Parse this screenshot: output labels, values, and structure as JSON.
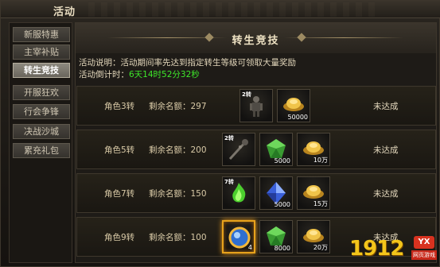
{
  "window": {
    "title": "活动"
  },
  "sidebar": {
    "items": [
      {
        "label": "新服特惠"
      },
      {
        "label": "主宰补贴"
      },
      {
        "label": "转生竞技"
      },
      {
        "label": "开服狂欢"
      },
      {
        "label": "行会争锋"
      },
      {
        "label": "决战沙城"
      },
      {
        "label": "累充礼包"
      }
    ],
    "active": "转生竞技"
  },
  "main": {
    "heading": "转生竞技",
    "description": "活动说明：活动期间率先达到指定转生等级可领取大量奖励",
    "countdown_label": "活动倒计时：",
    "countdown_value": "6天14时52分32秒",
    "rows": [
      {
        "role": "角色3转",
        "quota": "剩余名额：297",
        "status": "未达成",
        "rewards": [
          {
            "icon": "armor-figure-icon",
            "tag": "2转",
            "qty": ""
          },
          {
            "icon": "gold-ingot-icon",
            "tag": "",
            "qty": "50000"
          }
        ]
      },
      {
        "role": "角色5转",
        "quota": "剩余名额：200",
        "status": "未达成",
        "rewards": [
          {
            "icon": "spiked-club-icon",
            "tag": "2转",
            "qty": ""
          },
          {
            "icon": "green-gem-icon",
            "tag": "",
            "qty": "5000"
          },
          {
            "icon": "gold-ingot-icon",
            "tag": "",
            "qty": "10万"
          }
        ]
      },
      {
        "role": "角色7转",
        "quota": "剩余名额：150",
        "status": "未达成",
        "rewards": [
          {
            "icon": "green-flame-icon",
            "tag": "7转",
            "qty": ""
          },
          {
            "icon": "blue-crystal-icon",
            "tag": "",
            "qty": "5000"
          },
          {
            "icon": "gold-ingot-icon",
            "tag": "",
            "qty": "15万"
          }
        ]
      },
      {
        "role": "角色9转",
        "quota": "剩余名额：100",
        "status": "未达成",
        "rewards": [
          {
            "icon": "golden-orb-icon",
            "tag": "",
            "qty": "4"
          },
          {
            "icon": "green-gem-icon",
            "tag": "",
            "qty": "8000"
          },
          {
            "icon": "gold-ingot-icon",
            "tag": "",
            "qty": "20万"
          }
        ]
      }
    ]
  },
  "watermark": {
    "number": "1912",
    "badge": "YX",
    "sub": "网页游戏"
  },
  "colors": {
    "accent_green": "#3ee82a",
    "gold": "#e6b43a",
    "tab_active": "#8d897f"
  }
}
